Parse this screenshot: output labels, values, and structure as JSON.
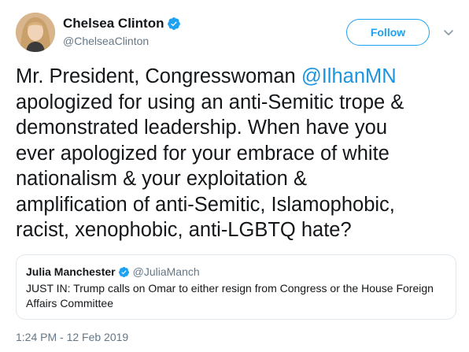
{
  "author": {
    "name": "Chelsea Clinton",
    "handle": "@ChelseaClinton",
    "avatar_icon": "user-avatar",
    "verified_icon": "verified-badge-icon",
    "verified_color": "#1da1f2"
  },
  "actions": {
    "follow_label": "Follow",
    "more_icon": "chevron-down-icon"
  },
  "tweet": {
    "line1_prefix": "Mr. President, Congresswoman ",
    "mention": "@IlhanMN",
    "line2": "apologized for using an anti-Semitic trope &",
    "line3": "demonstrated leadership. When have you",
    "line4": "ever apologized for your embrace of white",
    "line5": "nationalism & your exploitation &",
    "line6": "amplification of anti-Semitic, Islamophobic,",
    "line7": "racist, xenophobic, anti-LGBTQ hate?"
  },
  "quoted_tweet": {
    "name": "Julia Manchester",
    "handle": "@JuliaManch",
    "text": "JUST IN: Trump calls on Omar to either resign from Congress or the House Foreign Affairs Committee"
  },
  "timestamp": "1:24 PM - 12 Feb 2019",
  "colors": {
    "link": "#1b95e0",
    "accent": "#1da1f2",
    "secondary_text": "#657786",
    "border": "#e1e8ed"
  }
}
